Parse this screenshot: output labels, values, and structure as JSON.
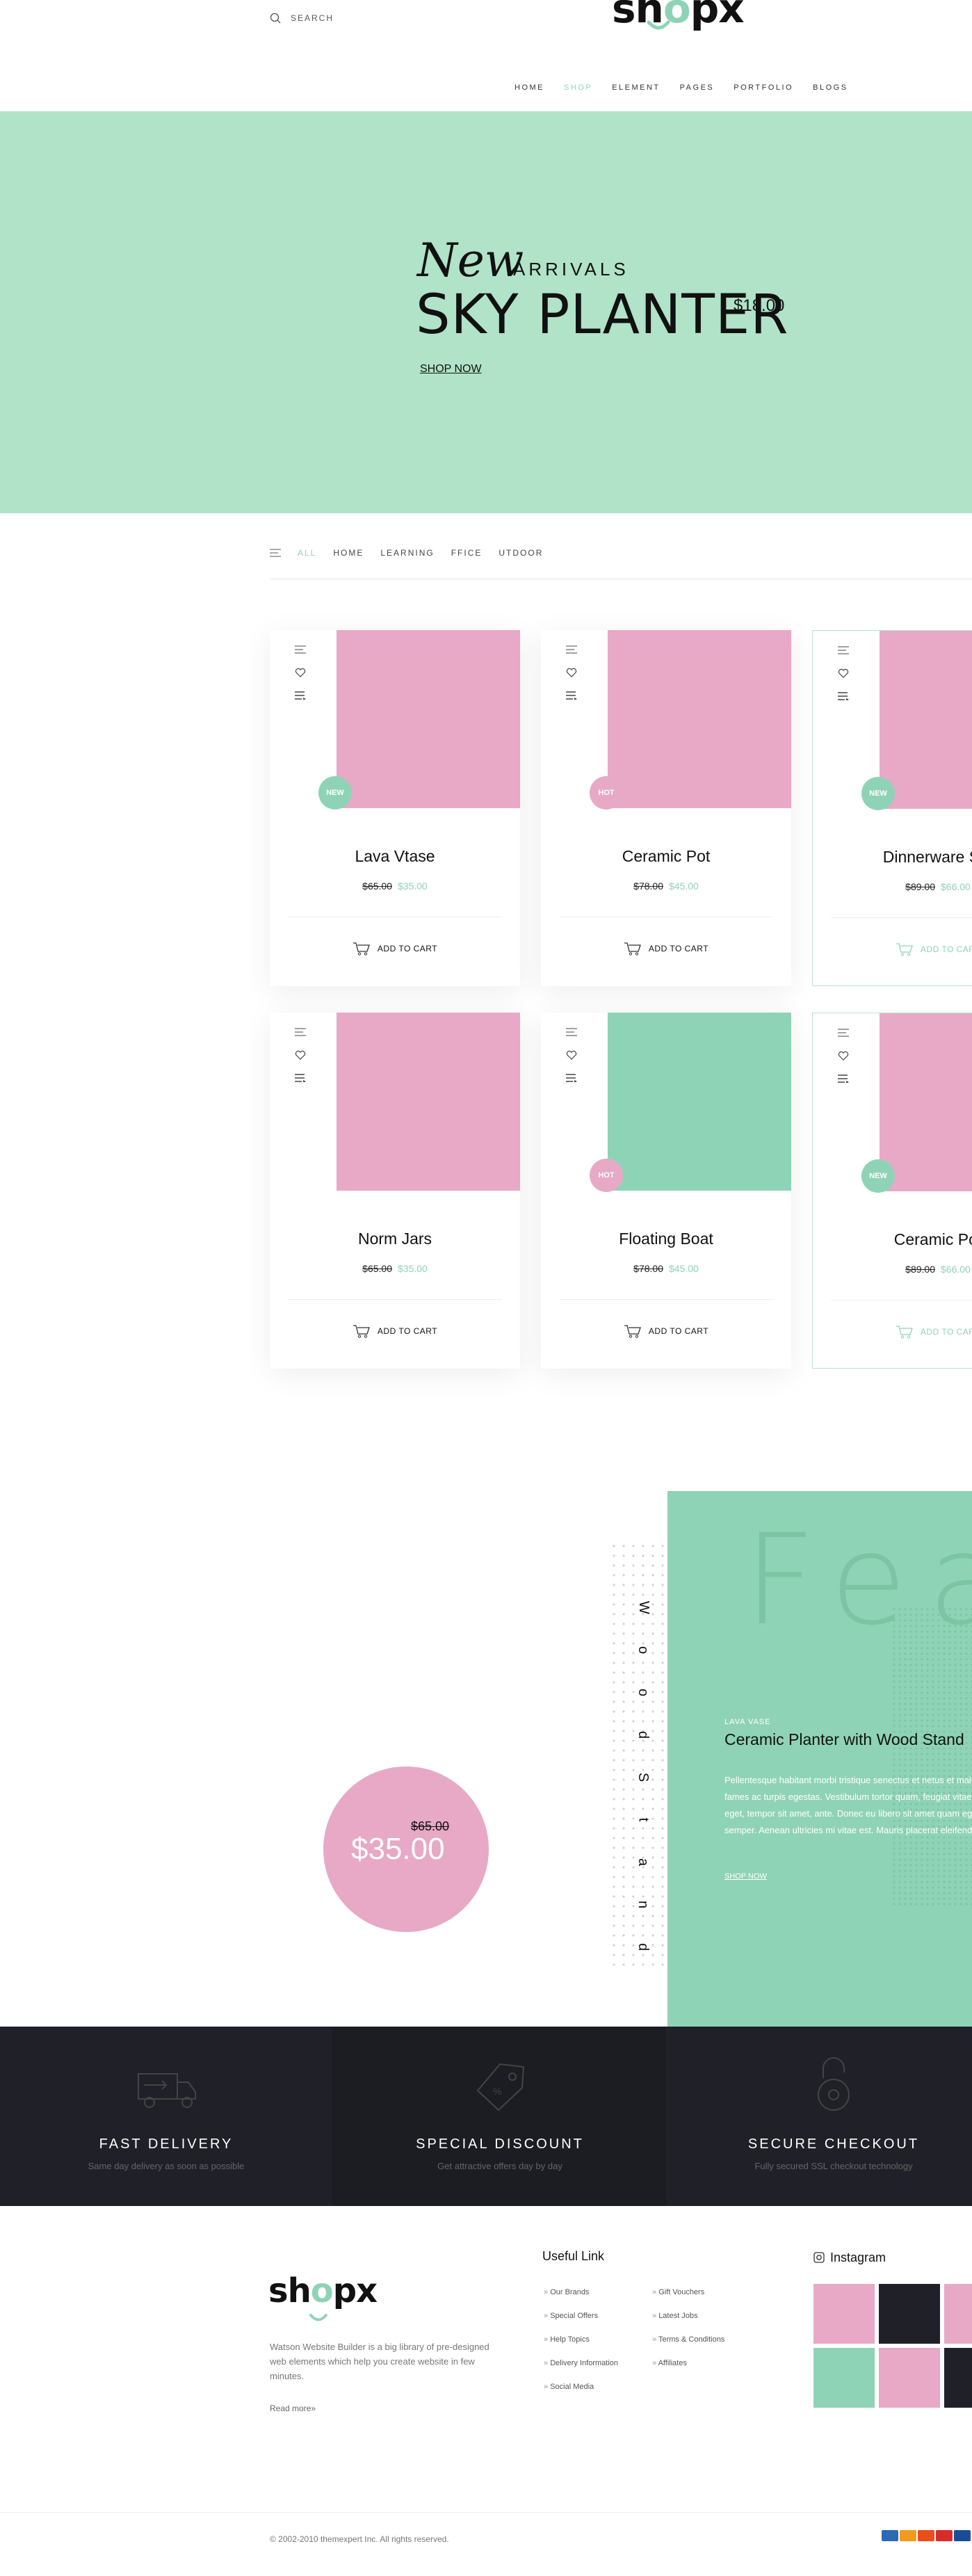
{
  "header": {
    "search_label": "SEARCH",
    "logo": {
      "pre": "sh",
      "o": "o",
      "post": "px"
    },
    "nav": [
      "HOME",
      "SHOP",
      "ELEMENT",
      "PAGES",
      "PORTFOLIO",
      "BLOGS"
    ],
    "nav_active": "SHOP"
  },
  "hero": {
    "script": "New",
    "arrivals": "ARRIVALS",
    "title": "SKY PLANTER",
    "price": "$18.00",
    "cta": "SHOP NOW"
  },
  "filter": {
    "items": [
      "ALL",
      "HOME",
      "LEARNING",
      "FFICE",
      "UTDOOR"
    ],
    "active": "ALL"
  },
  "products": [
    {
      "name": "Lava Vtase",
      "old": "$65.00",
      "price": "$35.00",
      "badge": "NEW",
      "img": "#e7a9c6",
      "cart": "ADD TO CART"
    },
    {
      "name": "Ceramic Pot",
      "old": "$78.00",
      "price": "$45.00",
      "badge": "HOT",
      "img": "#e7a9c6",
      "cart": "ADD TO CART"
    },
    {
      "name": "Dinnerware Set",
      "old": "$89.00",
      "price": "$66.00",
      "badge": "NEW",
      "img": "#e7a9c6",
      "cart": "ADD TO CART"
    },
    {
      "name": "Norm Jars",
      "old": "$65.00",
      "price": "$35.00",
      "badge": "",
      "img": "#e7a9c6",
      "cart": "ADD TO CART"
    },
    {
      "name": "Floating Boat",
      "old": "$78.00",
      "price": "$45.00",
      "badge": "HOT",
      "img": "#8fd3b6",
      "cart": "ADD TO CART"
    },
    {
      "name": "Ceramic Pot",
      "old": "$89.00",
      "price": "$66.00",
      "badge": "NEW",
      "img": "#e7a9c6",
      "cart": "ADD TO CART"
    }
  ],
  "featured": {
    "bg_word": "Featured",
    "vertical": [
      "W",
      "o",
      "o",
      "d",
      "S",
      "t",
      "a",
      "n",
      "d"
    ],
    "tag": "LAVA VASE",
    "title": "Ceramic Planter with Wood Stand",
    "text": [
      "Pellentesque habitant morbi tristique senectus et netus et malesuada",
      "fames ac turpis egestas. Vestibulum tortor quam, feugiat vitae",
      "eget, tempor sit amet, ante. Donec eu libero sit amet quam egestas",
      "semper. Aenean ultricies mi vitae est. Mauris placerat eleifend leo."
    ],
    "cta": "SHOP NOW",
    "old_price": "$65.00",
    "price": "$35.00"
  },
  "services": [
    {
      "icon": "truck-icon",
      "title": "FAST DELIVERY",
      "sub": "Same day delivery as soon as possible"
    },
    {
      "icon": "tag-icon",
      "title": "SPECIAL DISCOUNT",
      "sub": "Get attractive offers day by day"
    },
    {
      "icon": "lock-icon",
      "title": "SECURE CHECKOUT",
      "sub": "Fully secured SSL checkout technology"
    }
  ],
  "footer": {
    "desc": "Watson Website Builder is a big library of pre-designed web elements which help you create website in few minutes.",
    "read_more": "Read more»",
    "useful_title": "Useful Link",
    "links_left": [
      "Our Brands",
      "Special Offers",
      "Help Topics",
      "Delivery Information",
      "Social Media"
    ],
    "links_right": [
      "Gift Vouchers",
      "Latest Jobs",
      "Terms & Conditions",
      "Affiliates"
    ],
    "insta_title": "Instagram",
    "insta_colors": [
      "#e7a9c6",
      "#202028",
      "#e7a9c6",
      "#8fd3b6",
      "#e7a9c6",
      "#202028"
    ],
    "copyright": "© 2002-2010 themexpert Inc. All rights reserved."
  },
  "colors": {
    "mint": "#8fd3b6",
    "hero_mint": "#b0e3c8",
    "pink": "#e7a9c6",
    "dark": "#202028"
  }
}
